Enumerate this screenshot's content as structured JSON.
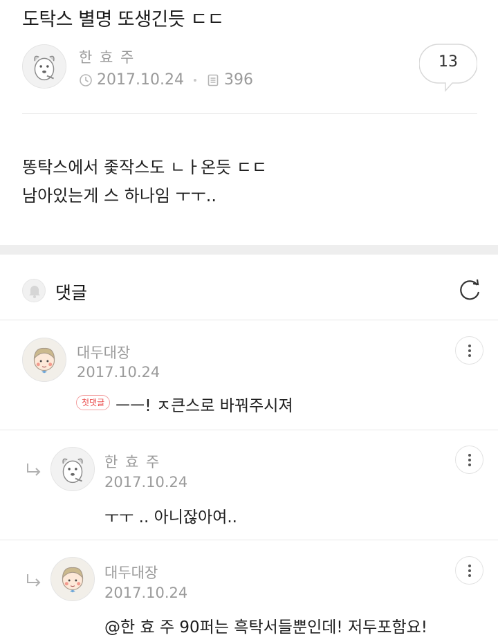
{
  "post": {
    "title": "도탁스 별명 또생긴듯 ㄷㄷ",
    "author": "한 효 주",
    "date": "2017.10.24",
    "views": "396",
    "comment_count": "13",
    "body_lines": [
      "똥탁스에서 좇작스도 ㄴㅏ온듯 ㄷㄷ",
      "남아있는게 스 하나임 ㅜㅜ.."
    ]
  },
  "comments_section": {
    "title": "댓글"
  },
  "comments": [
    {
      "author": "대두대장",
      "date": "2017.10.24",
      "badge": "첫댓글",
      "text": "ㅡㅡ! ㅈ큰스로 바꿔주시져"
    },
    {
      "author": "한 효 주",
      "date": "2017.10.24",
      "text": "ㅜㅜ .. 아니잖아여.."
    },
    {
      "author": "대두대장",
      "date": "2017.10.24",
      "text": "@한 효 주  90퍼는 흑탁서들뿐인데! 저두포함요!"
    }
  ],
  "colors": {
    "meta_gray": "#9a9a9a",
    "badge_red": "#ea4b4b",
    "separator": "#e2e2e2"
  },
  "icons": [
    "clock-icon",
    "document-icon",
    "speech-bubble-icon",
    "bell-icon",
    "refresh-icon",
    "more-vertical-icon",
    "reply-arrow-icon"
  ]
}
